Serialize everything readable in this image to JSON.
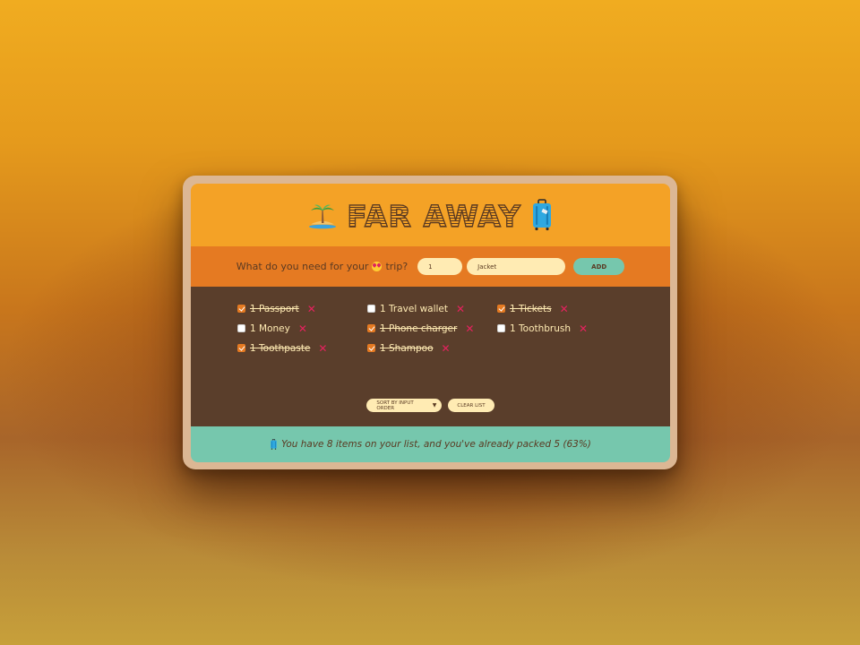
{
  "app": {
    "title": "FAR AWAY"
  },
  "form": {
    "label": "What do you need for your",
    "label_suffix": "trip?",
    "quantity_value": "1",
    "description_placeholder": "Jacket",
    "add_label": "ADD"
  },
  "items": [
    {
      "text": "1 Passport",
      "packed": true
    },
    {
      "text": "1 Travel wallet",
      "packed": false
    },
    {
      "text": "1 Tickets",
      "packed": true
    },
    {
      "text": "1 Money",
      "packed": false
    },
    {
      "text": "1 Phone charger",
      "packed": true
    },
    {
      "text": "1 Toothbrush",
      "packed": false
    },
    {
      "text": "1 Toothpaste",
      "packed": true
    },
    {
      "text": "1 Shampoo",
      "packed": true
    }
  ],
  "delete_glyph": "✕",
  "actions": {
    "sort_selected": "SORT BY INPUT ORDER",
    "clear_label": "CLEAR LIST"
  },
  "stats": {
    "text": "You have 8 items on your list, and you've already packed 5 (63%)"
  },
  "colors": {
    "header": "#f4a226",
    "form": "#e57a22",
    "list": "#5a3e2b",
    "footer": "#76c7ad",
    "cream": "#ffebb3",
    "delete": "#e5225e"
  },
  "icons": {
    "logo_left": "palm-island-icon",
    "logo_right": "luggage-icon",
    "form_emoji": "heart-eyes-icon",
    "footer_emoji": "luggage-icon"
  }
}
